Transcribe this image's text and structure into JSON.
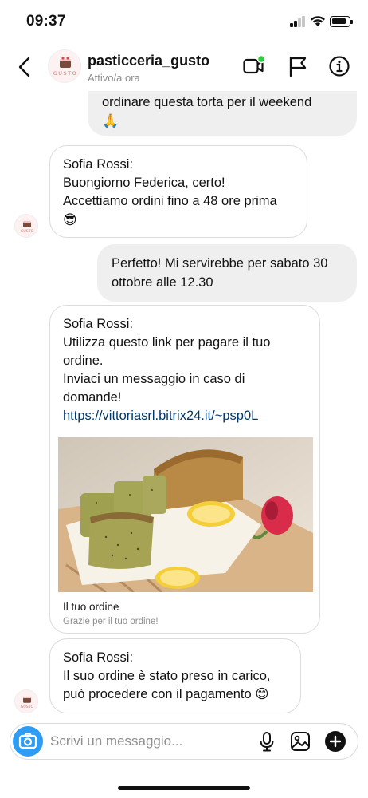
{
  "status_bar": {
    "time": "09:37",
    "icons": [
      "signal-icon",
      "wifi-icon",
      "battery-icon"
    ]
  },
  "header": {
    "title": "pasticceria_gusto",
    "subtitle": "Attivo/a ora",
    "avatar_text": "GUSTO",
    "icons": [
      "back-icon",
      "video-call-icon",
      "flag-icon",
      "info-icon"
    ],
    "online_color": "#2ecc40"
  },
  "messages": [
    {
      "id": "m1",
      "direction": "outgoing",
      "lines": [
        "ordinare questa torta per il weekend",
        "🙏"
      ]
    },
    {
      "id": "m2",
      "direction": "incoming",
      "lines": [
        "Sofia Rossi:",
        " Buongiorno Federica, certo!",
        "Accettiamo ordini fino a 48 ore prima",
        "😎"
      ]
    },
    {
      "id": "m3",
      "direction": "outgoing",
      "lines": [
        "Perfetto! Mi servirebbe per sabato 30",
        "ottobre alle 12.30"
      ]
    },
    {
      "id": "m4",
      "direction": "incoming",
      "lines": [
        "Sofia Rossi:",
        " Utilizza questo link per pagare il tuo",
        "ordine.",
        "Inviaci un messaggio in caso di",
        "domande!"
      ],
      "link": "https://vittoriasrl.bitrix24.it/~psp0L",
      "card": {
        "title": "Il tuo ordine",
        "subtitle": "Grazie per il tuo ordine!"
      }
    },
    {
      "id": "m5",
      "direction": "incoming",
      "lines": [
        "Sofia Rossi:",
        " Il suo ordine è stato preso in carico,",
        "può procedere con il pagamento 😊"
      ]
    }
  ],
  "composer": {
    "placeholder": "Scrivi un messaggio...",
    "icons": [
      "camera-icon",
      "microphone-icon",
      "gallery-icon",
      "add-icon"
    ],
    "camera_color": "#2f9cf4"
  },
  "colors": {
    "outgoing_bubble": "#efefef",
    "incoming_border": "#dbdbdb",
    "link": "#00376b"
  }
}
